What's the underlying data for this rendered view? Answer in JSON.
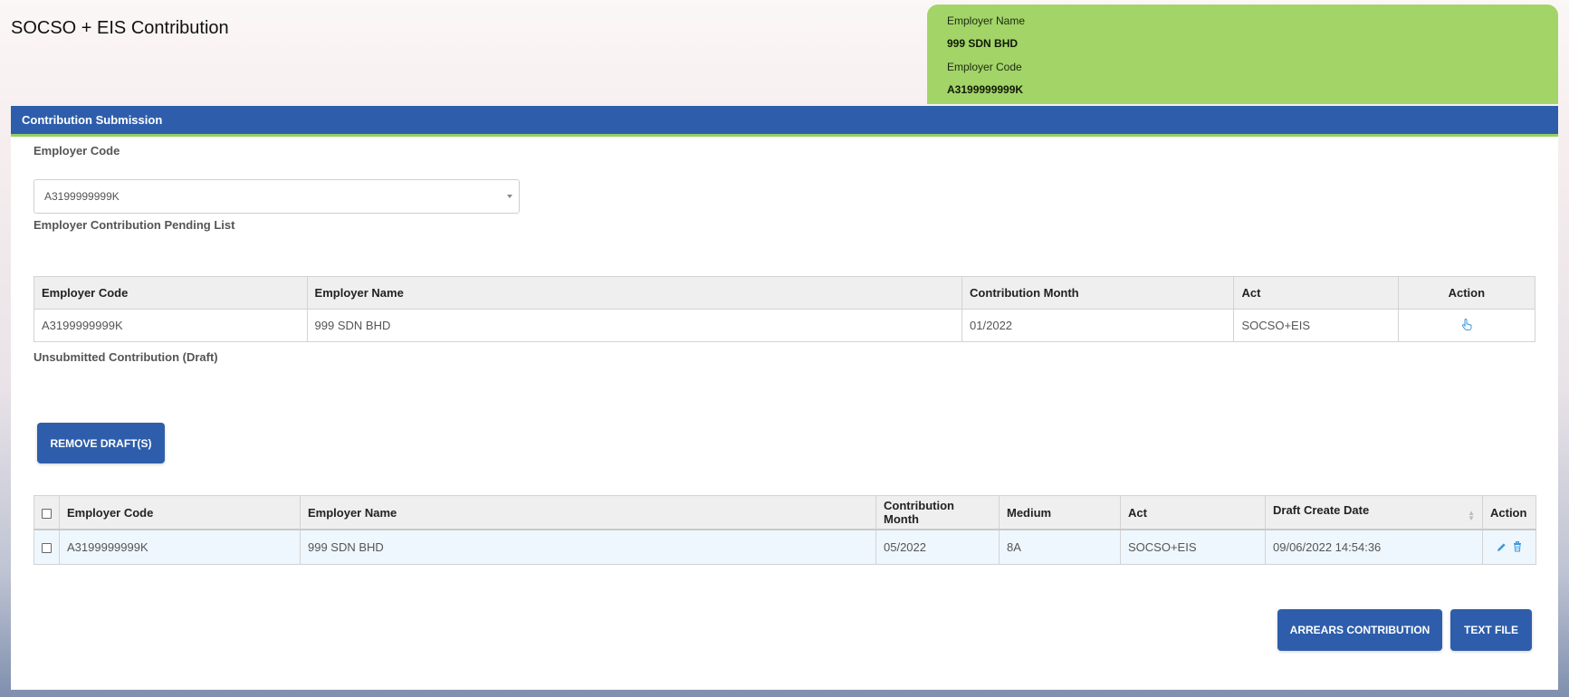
{
  "page": {
    "title": "SOCSO + EIS Contribution"
  },
  "employer_card": {
    "name_label": "Employer Name",
    "name_value": "999 SDN BHD",
    "code_label": "Employer Code",
    "code_value": "A3199999999K"
  },
  "panel": {
    "header": "Contribution Submission",
    "employer_code_label": "Employer Code",
    "employer_code_selected": "A3199999999K"
  },
  "pending": {
    "title": "Employer Contribution Pending List",
    "columns": [
      "Employer Code",
      "Employer Name",
      "Contribution Month",
      "Act",
      "Action"
    ],
    "rows": [
      {
        "employer_code": "A3199999999K",
        "employer_name": "999 SDN BHD",
        "month": "01/2022",
        "act": "SOCSO+EIS",
        "action_icon": "hand-pointer-icon"
      }
    ]
  },
  "draft": {
    "title": "Unsubmitted Contribution (Draft)",
    "remove_button": "REMOVE DRAFT(S)",
    "columns": [
      "Employer Code",
      "Employer Name",
      "Contribution Month",
      "Medium",
      "Act",
      "Draft Create Date",
      "Action"
    ],
    "rows": [
      {
        "employer_code": "A3199999999K",
        "employer_name": "999 SDN BHD",
        "month": "05/2022",
        "medium": "8A",
        "act": "SOCSO+EIS",
        "created": "09/06/2022 14:54:36",
        "edit_icon": "pencil-icon",
        "delete_icon": "trash-icon"
      }
    ]
  },
  "buttons": {
    "arrears": "ARREARS CONTRIBUTION",
    "text_file": "TEXT FILE"
  },
  "colors": {
    "primary": "#2e5eab",
    "card": "#a3d468",
    "icon_blue": "#3a98e0"
  }
}
